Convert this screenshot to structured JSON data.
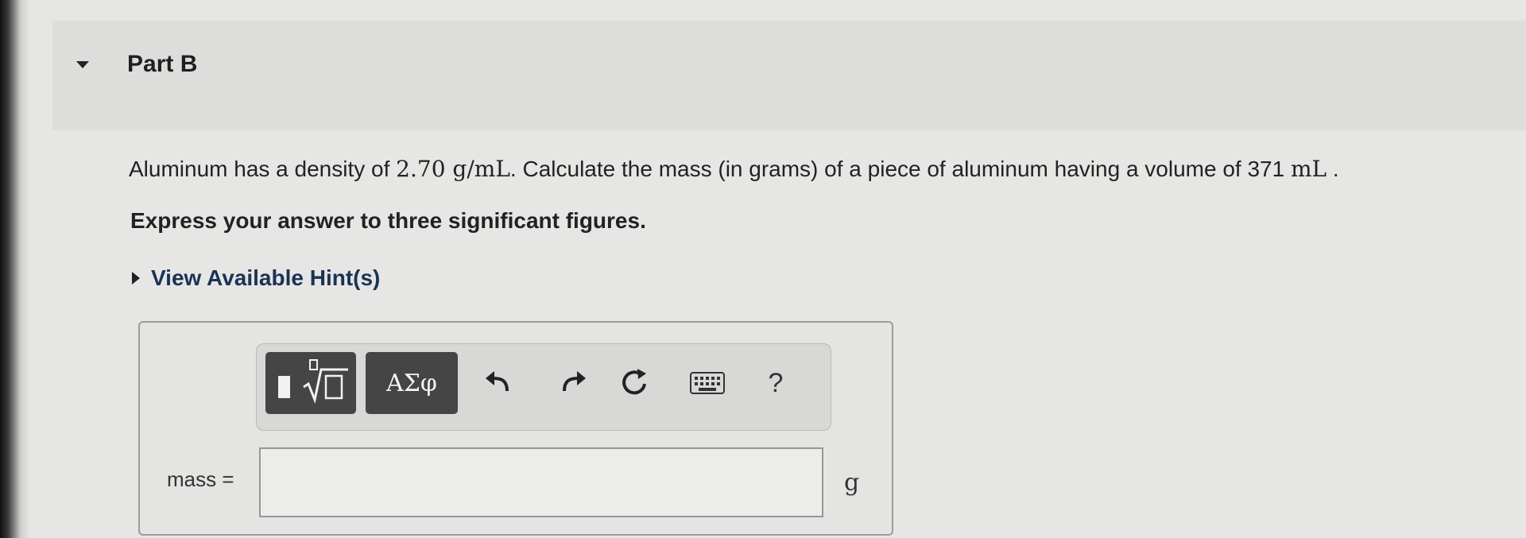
{
  "part": {
    "title": "Part B"
  },
  "question": {
    "text_before": "Aluminum has a density of ",
    "density_value": "2.70",
    "density_unit": " g/mL",
    "text_middle": ". Calculate the mass (in grams) of a piece of aluminum having a volume of 371 ",
    "volume_unit": "mL",
    "text_end": " ."
  },
  "instruction": "Express your answer to three significant figures.",
  "hint": {
    "label": "View Available Hint(s)"
  },
  "toolbar": {
    "templates_icon": "templates-sqrt-icon",
    "greek_label": "ΑΣφ",
    "undo_icon": "undo-icon",
    "redo_icon": "redo-icon",
    "reset_icon": "reset-icon",
    "keyboard_icon": "keyboard-icon",
    "help_label": "?"
  },
  "answer": {
    "label": "mass =",
    "value": "",
    "unit": "g"
  }
}
